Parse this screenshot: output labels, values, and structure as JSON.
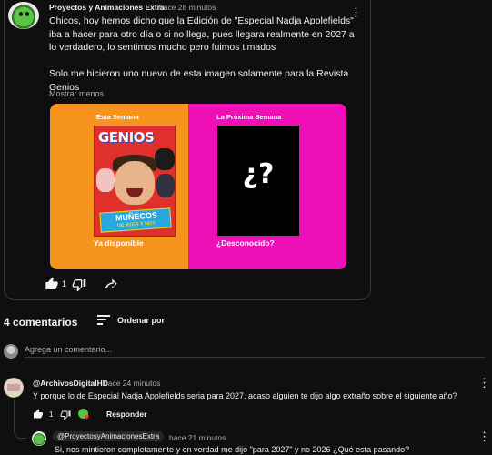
{
  "post": {
    "author": "Proyectos y Animaciones Extra",
    "time": "hace 28 minutos",
    "paragraph1": "Chicos, hoy hemos dicho que la Edición de \"Especial Nadja Applefields\" iba a hacer para otro día o si no llega, pues llegara realmente en 2027 a lo verdadero, lo sentimos mucho pero fuimos timados",
    "paragraph2": "Solo me hicieron uno nuevo de esta imagen solamente para la Revista Genios",
    "show_less": "Mostrar menos",
    "like_count": "1",
    "image": {
      "left_title": "Esta Semana",
      "left_caption": "Ya disponible",
      "right_title": "La Próxima Semana",
      "right_caption": "¿Desconocido?",
      "magazine_logo": "GENIOS",
      "magazine_banner": "MUÑECOS",
      "magazine_banner_sub": "DE AYER Y HOY",
      "mystery_text": "¿?",
      "colors": {
        "left": "#f7941d",
        "right": "#ee10b6"
      }
    }
  },
  "comments_section": {
    "count_label": "4 comentarios",
    "sort_label": "Ordenar por",
    "add_placeholder": "Agrega un comentario..."
  },
  "comments": [
    {
      "author": "@ArchivosDigitalHD",
      "time": "hace 24 minutos",
      "text": "Y porque lo de Especial Nadja Applefields seria para 2027, acaso alguien te dijo algo extraño sobre el siguiente año?",
      "like_count": "1",
      "reply_label": "Responder"
    }
  ],
  "replies": [
    {
      "author": "@ProyectosyAnimacionesExtra",
      "time": "hace 21 minutos",
      "text": "Si, nos mintieron completamente y en verdad me dijo \"para 2027\" y no 2026 ¿Qué esta pasando?"
    }
  ]
}
